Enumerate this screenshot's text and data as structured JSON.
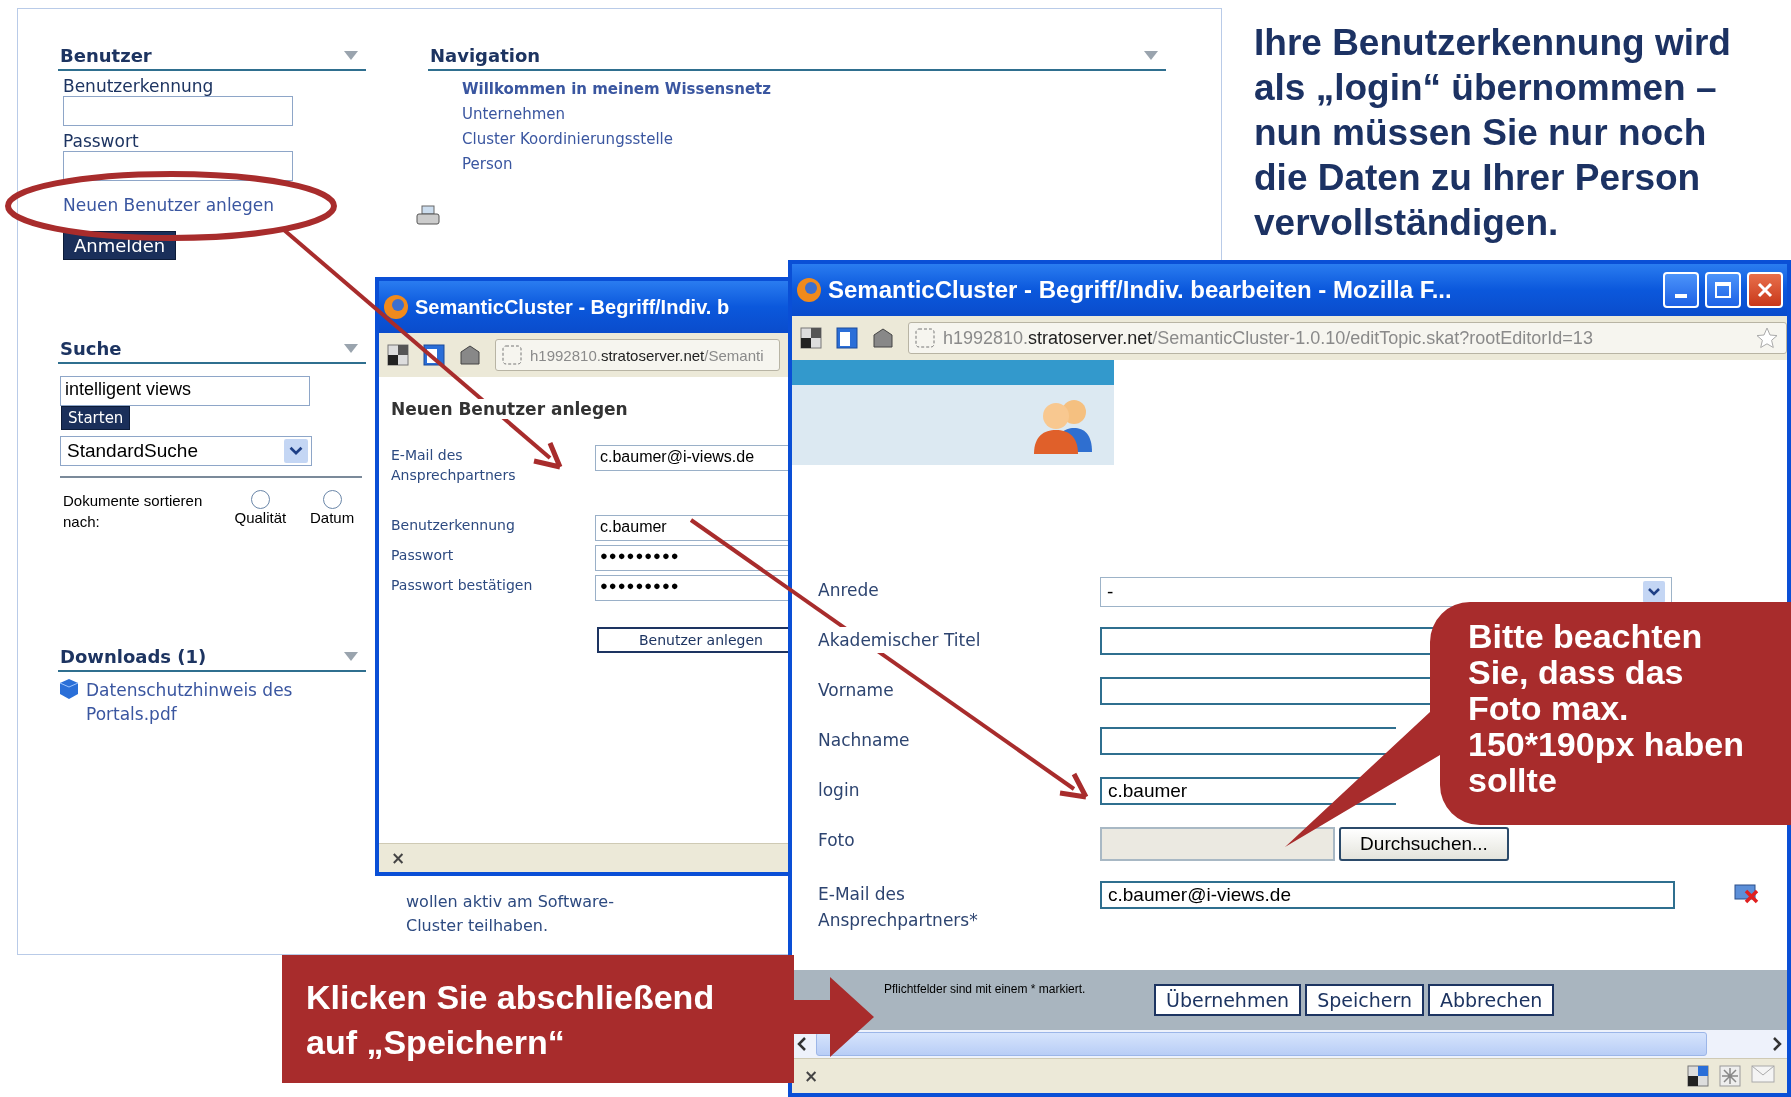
{
  "portal": {
    "sidebar": {
      "login": {
        "title": "Benutzer",
        "user_label": "Benutzerkennung",
        "password_label": "Passwort",
        "register_link": "Neuen Benutzer anlegen",
        "login_button": "Anmelden"
      },
      "search": {
        "title": "Suche",
        "query": "intelligent views",
        "start_button": "Starten",
        "search_type": "StandardSuche",
        "sort_label": "Dokumente sortieren nach:",
        "sort_options": [
          {
            "label": "Qualität",
            "selected": false
          },
          {
            "label": "Datum",
            "selected": false
          }
        ]
      },
      "downloads": {
        "title": "Downloads (1)",
        "items": [
          "Datenschutzhinweis des Portals.pdf"
        ]
      }
    },
    "navigation": {
      "title": "Navigation",
      "items": [
        {
          "label": "Willkommen in meinem Wissensnetz",
          "selected": true
        },
        {
          "label": "Unternehmen",
          "selected": false
        },
        {
          "label": "Cluster Koordinierungsstelle",
          "selected": false
        },
        {
          "label": "Person",
          "selected": false
        }
      ]
    },
    "content_text": "wollen aktiv am Software-Cluster teilhaben."
  },
  "instruction": "Ihre Benutzerkennung wird als „login“ übernommen – nun müssen Sie nur noch die Daten zu Ihrer Person vervollständigen.",
  "register_window": {
    "title": "SemanticCluster - Begriff/Indiv. b",
    "url": {
      "prefix": "h1992810.",
      "domain": "stratoserver.net",
      "path": "/Semanti"
    },
    "heading": "Neuen Benutzer anlegen",
    "fields": [
      {
        "kind": "text",
        "label": "E-Mail des Ansprechpartners",
        "value": "c.baumer@i-views.de"
      },
      {
        "kind": "text",
        "label": "Benutzerkennung",
        "value": "c.baumer"
      },
      {
        "kind": "password",
        "label": "Passwort",
        "value": "●●●●●●●●●"
      },
      {
        "kind": "password",
        "label": "Passwort bestätigen",
        "value": "●●●●●●●●●"
      }
    ],
    "submit": "Benutzer anlegen",
    "status_close": "×"
  },
  "edit_window": {
    "title": "SemanticCluster - Begriff/Indiv. bearbeiten - Mozilla F...",
    "url": {
      "prefix": "h1992810.",
      "domain": "stratoserver.net",
      "path": "/SemanticCluster-1.0.10/editTopic.skat?rootEditorId=13"
    },
    "fields": [
      {
        "kind": "select",
        "label": "Anrede",
        "value": "-"
      },
      {
        "kind": "text",
        "label": "Akademischer Titel"
      },
      {
        "kind": "text",
        "label": "Vorname"
      },
      {
        "kind": "text",
        "label": "Nachname"
      },
      {
        "kind": "text",
        "label": "login",
        "value": "c.baumer"
      },
      {
        "kind": "file",
        "label": "Foto",
        "button": "Durchsuchen..."
      },
      {
        "kind": "text",
        "label": "E-Mail des Ansprechpartners*",
        "value": "c.baumer@i-views.de",
        "removable": true
      }
    ],
    "required_note": "Pflichtfelder sind mit einem * markiert.",
    "buttons": [
      "Übernehmen",
      "Speichern",
      "Abbrechen"
    ],
    "status_close": "×"
  },
  "callouts": {
    "photo_note": "Bitte beachten Sie, dass das Foto max. 150*190px haben sollte",
    "save_note": "Klicken Sie abschließend auf „Speichern“"
  }
}
